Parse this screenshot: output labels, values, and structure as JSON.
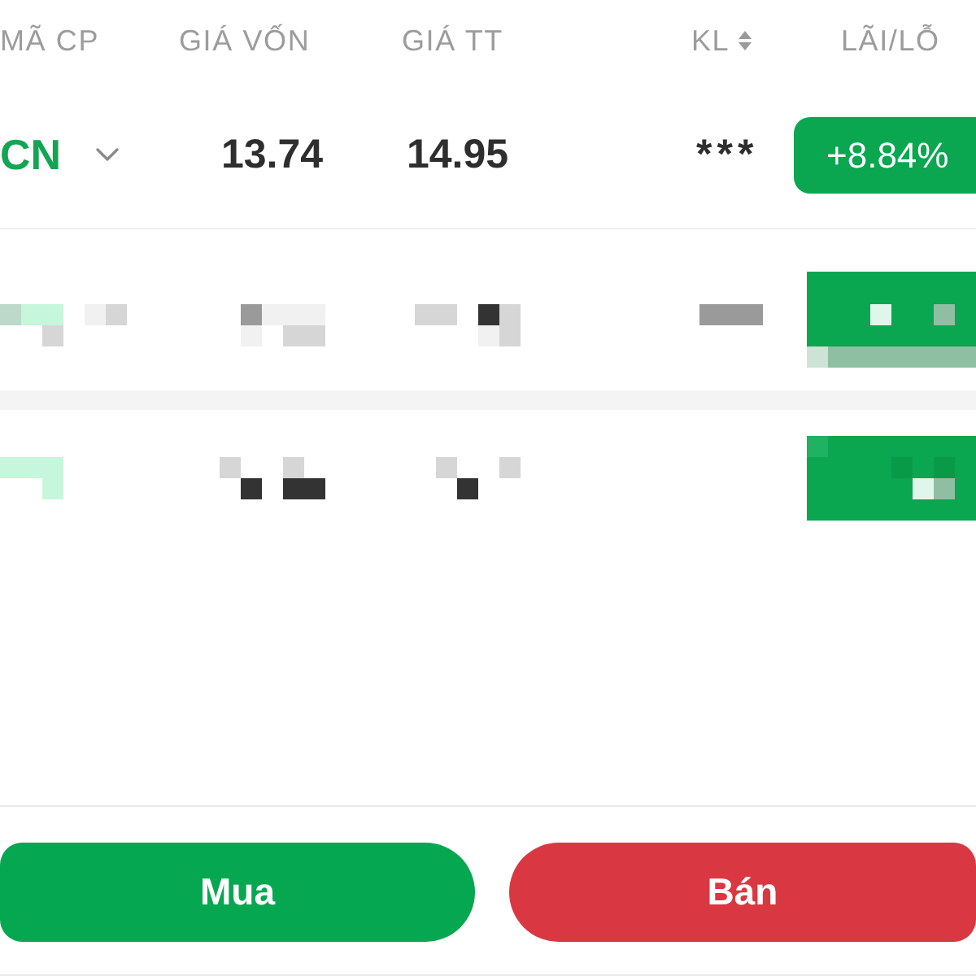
{
  "table": {
    "columns": [
      {
        "label": "MÃ CP",
        "sortable": false
      },
      {
        "label": "GIÁ VỐN",
        "sortable": false
      },
      {
        "label": "GIÁ TT",
        "sortable": false
      },
      {
        "label": "KL",
        "sortable": true
      },
      {
        "label": "LÃI/LỖ",
        "sortable": false
      }
    ],
    "rows": [
      {
        "kind": "stock",
        "ticker": "CN",
        "expanded": false,
        "cost_price": "13.74",
        "market_price": "14.95",
        "volume": "***",
        "profit_loss": "+8.84%"
      },
      {
        "kind": "masked"
      },
      {
        "kind": "masked"
      }
    ]
  },
  "actions": [
    {
      "kind": "buy",
      "label": "Mua"
    },
    {
      "kind": "sell",
      "label": "Bán"
    }
  ]
}
